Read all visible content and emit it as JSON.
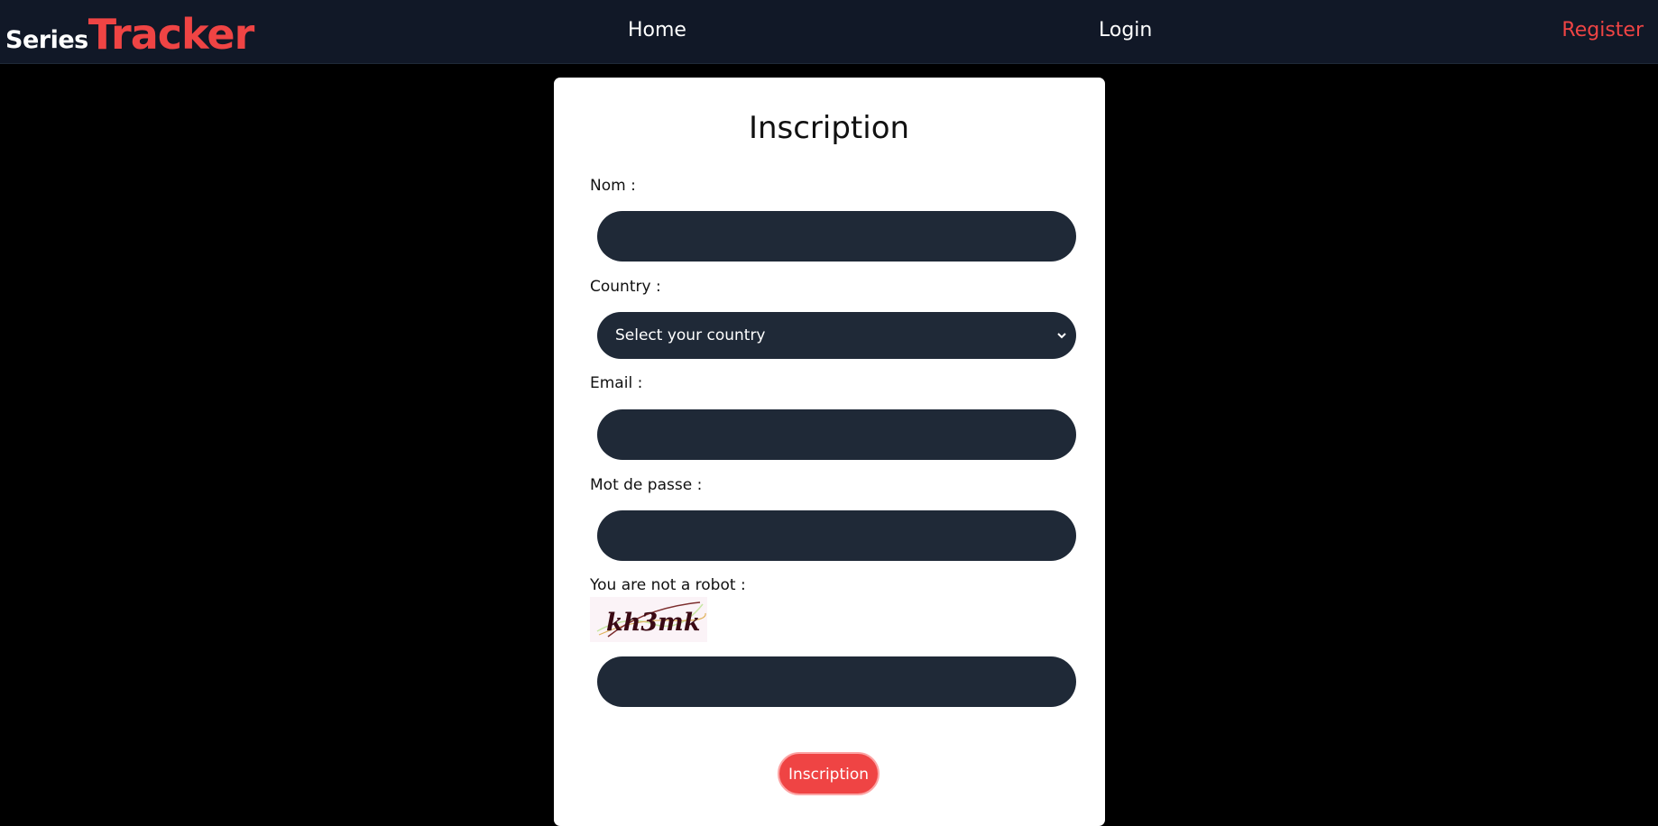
{
  "brand": {
    "series": "Series",
    "tracker": "Tracker"
  },
  "nav": {
    "home": "Home",
    "login": "Login",
    "register": "Register"
  },
  "form": {
    "title": "Inscription",
    "nom_label": "Nom :",
    "nom_value": "",
    "country_label": "Country :",
    "country_selected": "Select your country",
    "email_label": "Email :",
    "email_value": "",
    "password_label": "Mot de passe :",
    "password_value": "",
    "captcha_label": "You are not a robot :",
    "captcha_text": "kh3mk",
    "captcha_value": "",
    "submit_label": "Inscription"
  },
  "colors": {
    "navbar_bg": "#111827",
    "accent": "#ef4444",
    "input_bg": "#1f2937",
    "page_bg": "#000000",
    "card_bg": "#ffffff"
  },
  "icons": {
    "select_arrow": "chevron-down-icon"
  }
}
